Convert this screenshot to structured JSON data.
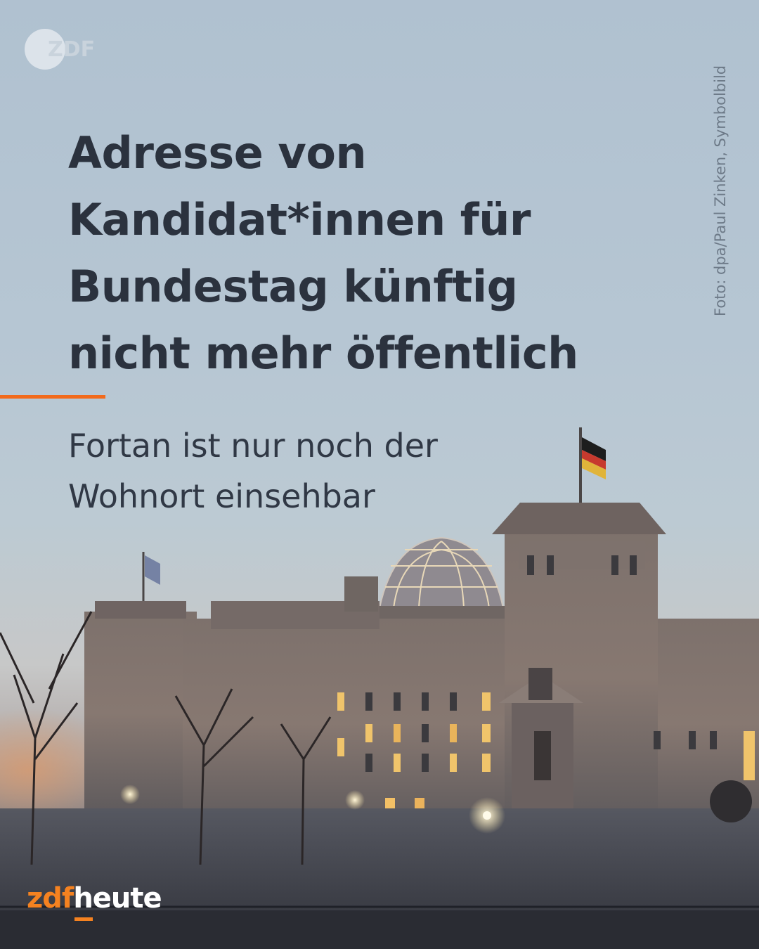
{
  "headline": {
    "lines": [
      "Adresse von",
      "Kandidat*innen für",
      "Bundestag künftig",
      "nicht mehr öffentlich"
    ]
  },
  "subline": {
    "lines": [
      "Fortan ist nur noch der",
      "Wohnort einsehbar"
    ]
  },
  "photo_credit": "Foto: dpa/Paul Zinken, Symbolbild",
  "logo": {
    "watermark": "ZDF"
  },
  "brand": {
    "part1": "zdf",
    "part2": "heute"
  },
  "colors": {
    "accent": "#f26a1b",
    "headline": "#2b323e",
    "sky": "#b4c4d2"
  }
}
